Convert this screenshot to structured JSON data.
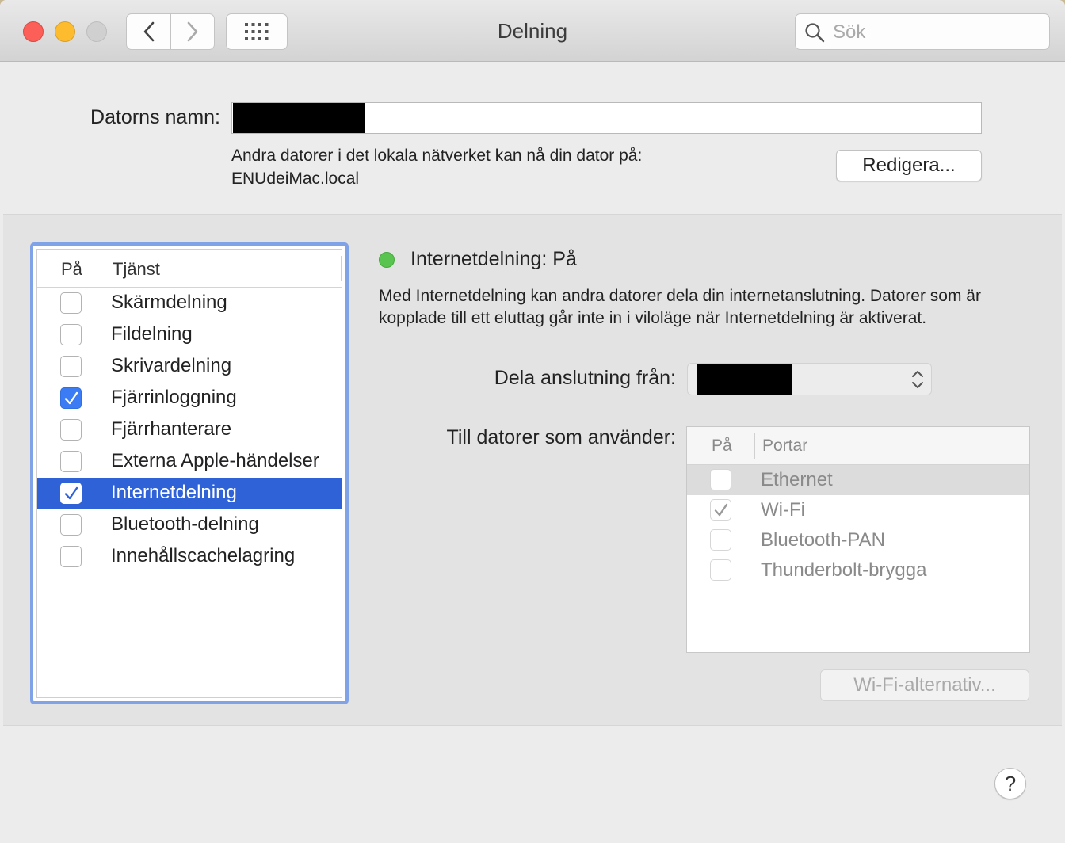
{
  "window": {
    "title": "Delning"
  },
  "toolbar": {
    "search_placeholder": "Sök"
  },
  "computer_name": {
    "label": "Datorns namn:",
    "info_line1": "Andra datorer i det lokala nätverket kan nå din dator på:",
    "info_line2": "ENUdeiMac.local",
    "edit_label": "Redigera..."
  },
  "services": {
    "header_on": "På",
    "header_service": "Tjänst",
    "items": [
      {
        "label": "Skärmdelning",
        "checked": false,
        "selected": false
      },
      {
        "label": "Fildelning",
        "checked": false,
        "selected": false
      },
      {
        "label": "Skrivardelning",
        "checked": false,
        "selected": false
      },
      {
        "label": "Fjärrinloggning",
        "checked": true,
        "selected": false
      },
      {
        "label": "Fjärrhanterare",
        "checked": false,
        "selected": false
      },
      {
        "label": "Externa Apple-händelser",
        "checked": false,
        "selected": false
      },
      {
        "label": "Internetdelning",
        "checked": true,
        "selected": true
      },
      {
        "label": "Bluetooth-delning",
        "checked": false,
        "selected": false
      },
      {
        "label": "Innehållscachelagring",
        "checked": false,
        "selected": false
      }
    ]
  },
  "detail": {
    "status": "Internetdelning: På",
    "status_color": "#5ac451",
    "description": "Med Internetdelning kan andra datorer dela din internetanslutning. Datorer som är kopplade till ett eluttag går inte in i viloläge när Internetdelning är aktiverat.",
    "share_from_label": "Dela anslutning från:",
    "to_computers_label": "Till datorer som använder:",
    "ports_header_on": "På",
    "ports_header_ports": "Portar",
    "ports": [
      {
        "label": "Ethernet",
        "checked": false
      },
      {
        "label": "Wi-Fi",
        "checked": true
      },
      {
        "label": "Bluetooth-PAN",
        "checked": false
      },
      {
        "label": "Thunderbolt-brygga",
        "checked": false
      }
    ],
    "wifi_options_label": "Wi-Fi-alternativ..."
  },
  "help_label": "?",
  "colors": {
    "selection": "#2f62d7",
    "list_focus_ring": "#7fa3e6",
    "checkbox_checked": "#3b7cf5"
  }
}
